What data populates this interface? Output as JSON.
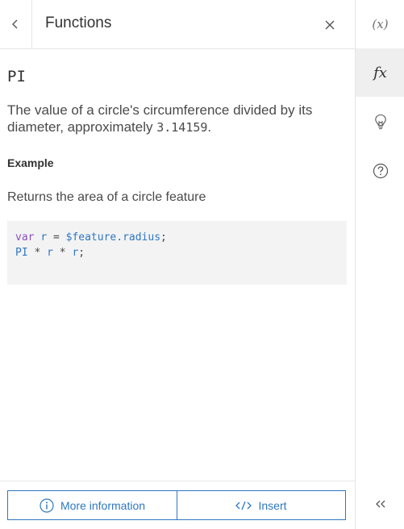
{
  "header": {
    "title": "Functions"
  },
  "function": {
    "name": "PI",
    "description_prefix": "The value of a circle's circumference divided by its diameter, approximately ",
    "description_value": "3.14159",
    "description_suffix": "."
  },
  "example": {
    "heading": "Example",
    "description": "Returns the area of a circle feature",
    "code": {
      "line1": {
        "keyword": "var",
        "name": "r",
        "op": "=",
        "value": "$feature.radius",
        "end": ";"
      },
      "line2": {
        "fn": "PI",
        "op1": "*",
        "a": "r",
        "op2": "*",
        "b": "r",
        "end": ";"
      }
    }
  },
  "footer": {
    "more_info_label": "More information",
    "insert_label": "Insert"
  },
  "rail": {
    "variables_label": "(x)",
    "functions_label": "fx"
  },
  "icons": {
    "back": "chevron-left-icon",
    "close": "close-icon",
    "info": "info-icon",
    "code": "code-icon",
    "hint": "lightbulb-icon",
    "help": "question-icon",
    "collapse": "chevrons-left-icon"
  },
  "colors": {
    "accent": "#2f77c2",
    "rail_active_bg": "#efefef",
    "code_bg": "#f3f3f3",
    "keyword": "#8a4fbf"
  }
}
